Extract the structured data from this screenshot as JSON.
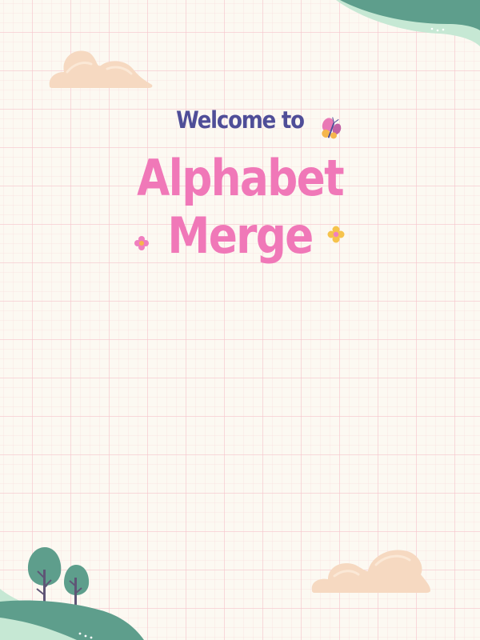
{
  "screen": {
    "welcome_text": "Welcome to",
    "title_line1": "Alphabet",
    "title_line2": "Merge"
  },
  "decorations": {
    "icons": [
      "cloud-icon",
      "butterfly-icon",
      "flower-icon",
      "tree-icon",
      "hill-icon"
    ]
  },
  "colors": {
    "background": "#fcf9f2",
    "grid": "#f5c4cc",
    "welcome": "#4f4e98",
    "title": "#f078b8",
    "cloud": "#f6d9c1",
    "hill_dark": "#5e9e8c",
    "hill_light": "#c6e8d4"
  }
}
